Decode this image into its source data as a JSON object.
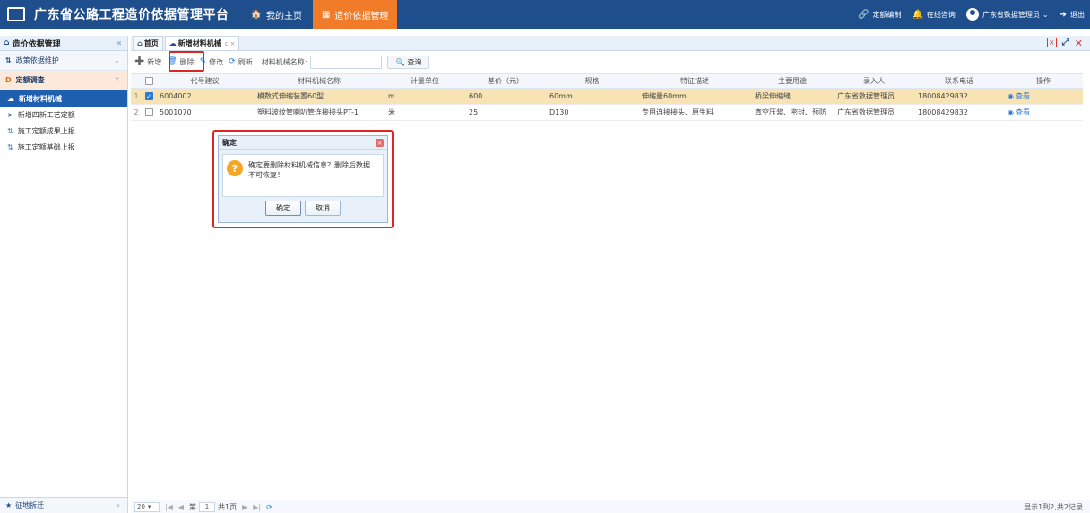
{
  "header": {
    "title": "广东省公路工程造价依据管理平台",
    "nav": [
      {
        "label": "我的主页",
        "icon": "home-icon"
      },
      {
        "label": "造价依据管理",
        "icon": "grid-icon"
      }
    ],
    "right": {
      "quota_edit": "定额编制",
      "online_consult": "在线咨询",
      "user": "广东省数据管理员",
      "logout": "退出"
    }
  },
  "sidebar": {
    "title": "造价依据管理",
    "groups": [
      {
        "label": "政策依据维护"
      },
      {
        "label": "定额调查"
      }
    ],
    "items": [
      {
        "label": "新增材料机械"
      },
      {
        "label": "新增四新工艺定额"
      },
      {
        "label": "施工定额成果上报"
      },
      {
        "label": "施工定额基础上报"
      }
    ],
    "bottom": "征地拆迁"
  },
  "tabs": [
    {
      "label": "首页"
    },
    {
      "label": "新增材料机械"
    }
  ],
  "toolbar": {
    "add": "新增",
    "delete": "删除",
    "edit": "修改",
    "refresh": "刷新",
    "name_label": "材料机械名称:",
    "name_value": "",
    "search": "查询"
  },
  "grid": {
    "columns": [
      "代号建议",
      "材料机械名称",
      "计量单位",
      "基价（元）",
      "规格",
      "特征描述",
      "主要用途",
      "录入人",
      "联系电话",
      "操作"
    ],
    "rows": [
      {
        "idx": "1",
        "checked": true,
        "code": "6004002",
        "name": "模数式伸缩装置60型",
        "unit": "m",
        "price": "600",
        "spec": "60mm",
        "feature": "伸缩量60mm",
        "use": "桥梁伸缩缝",
        "entry": "广东省数据管理员",
        "phone": "18008429832",
        "op": "查看"
      },
      {
        "idx": "2",
        "checked": false,
        "code": "5001070",
        "name": "塑料波纹管喇叭管连接接头PT-1",
        "unit": "米",
        "price": "25",
        "spec": "D130",
        "feature": "专用连接接头、原生料",
        "use": "真空压浆、密封、预防",
        "entry": "广东省数据管理员",
        "phone": "18008429832",
        "op": "查看"
      }
    ]
  },
  "pager": {
    "page_size": "20",
    "page_label_pre": "第",
    "page_num": "1",
    "page_label_post": "共1页",
    "info": "显示1到2,共2记录"
  },
  "dialog": {
    "title": "确定",
    "message": "确定要删除材料机械信息？删除后数据不可恢复！",
    "ok": "确定",
    "cancel": "取消"
  },
  "colors": {
    "header_bg": "#1f4e8c",
    "accent": "#f07c2a",
    "highlight": "#e02424",
    "selected_row": "#f8e3b4"
  }
}
